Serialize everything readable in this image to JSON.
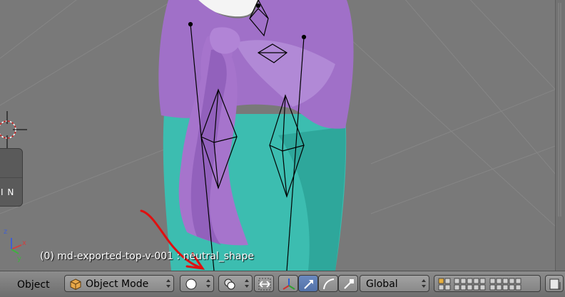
{
  "viewport": {
    "object_label": "(0) md-exported-top-v-001 : neutral_shape",
    "side_panel_label": "I N",
    "axis_labels": {
      "x": "x",
      "y": "y",
      "z": "z"
    }
  },
  "colors": {
    "viewport_bg": "#797979",
    "garment_purple": "#a070c8",
    "garment_teal": "#3cbdb0",
    "annotation_red": "#e01010",
    "header_active": "#5a7ab5"
  },
  "header": {
    "menu_label": "Object",
    "mode": {
      "value": "Object Mode",
      "icon": "cube-icon"
    },
    "shading": {
      "icon": "solid-sphere-icon"
    },
    "pivot": {
      "icon": "pivot-point-icon"
    },
    "snap_icon": "snap-arrows-icon",
    "manipulators": [
      {
        "icon": "translate-manipulator-icon",
        "active": false
      },
      {
        "icon": "translate-arrow-icon",
        "active": true
      },
      {
        "icon": "rotate-manipulator-icon",
        "active": false
      },
      {
        "icon": "scale-manipulator-icon",
        "active": false
      }
    ],
    "orientation": {
      "value": "Global"
    },
    "layers_icon": "layers-grid-icon"
  }
}
